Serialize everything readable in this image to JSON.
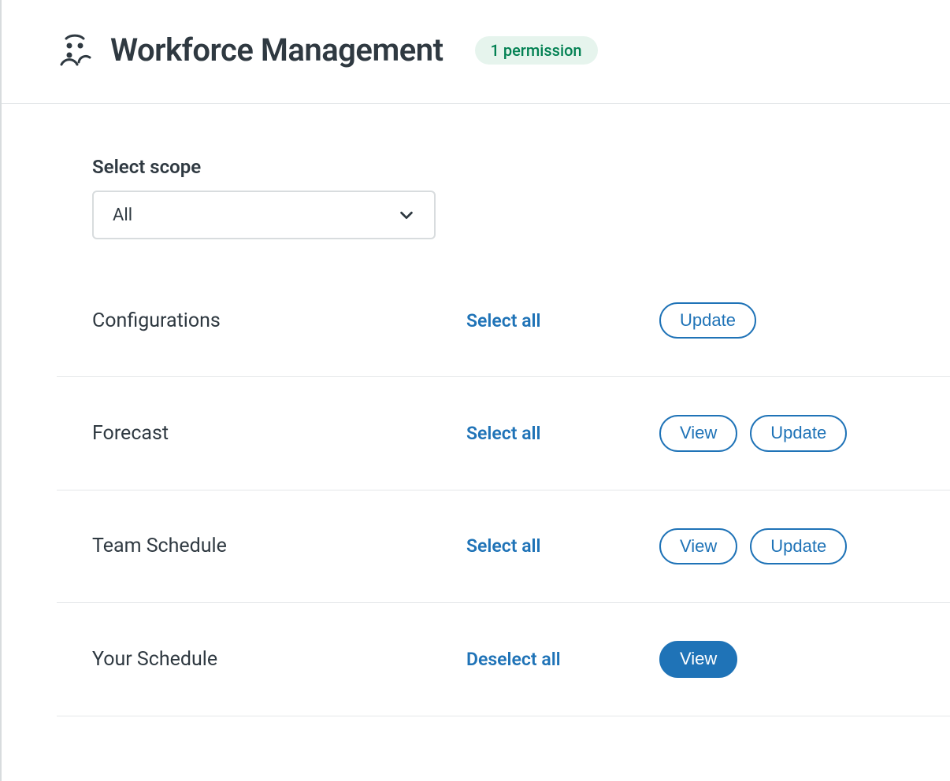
{
  "header": {
    "title": "Workforce Management",
    "badge": "1 permission"
  },
  "scope": {
    "label": "Select scope",
    "selected": "All"
  },
  "rows": [
    {
      "label": "Configurations",
      "toggle_link": "Select all",
      "actions": [
        {
          "label": "Update",
          "selected": false
        }
      ]
    },
    {
      "label": "Forecast",
      "toggle_link": "Select all",
      "actions": [
        {
          "label": "View",
          "selected": false
        },
        {
          "label": "Update",
          "selected": false
        }
      ]
    },
    {
      "label": "Team Schedule",
      "toggle_link": "Select all",
      "actions": [
        {
          "label": "View",
          "selected": false
        },
        {
          "label": "Update",
          "selected": false
        }
      ]
    },
    {
      "label": "Your Schedule",
      "toggle_link": "Deselect all",
      "actions": [
        {
          "label": "View",
          "selected": true
        }
      ]
    }
  ]
}
